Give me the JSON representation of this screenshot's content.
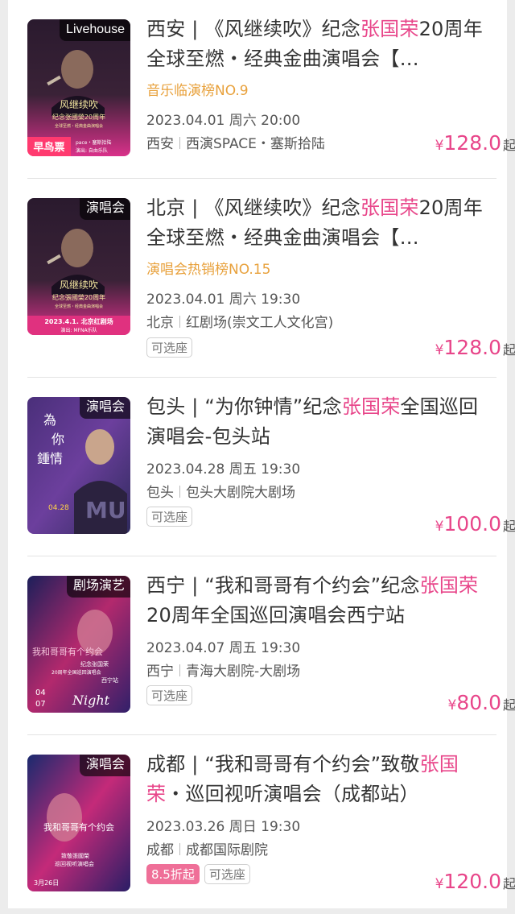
{
  "items": [
    {
      "tag": "Livehouse",
      "title_pre": "西安 | 《风继续吹》纪念",
      "title_hl": "张国荣",
      "title_post": "20周年全球至燃・经典金曲演唱会【…",
      "rank": "音乐临演榜NO.9",
      "date": "2023.04.01 周六 20:00",
      "city": "西安",
      "venue": "西演SPACE・塞斯拾陆",
      "badges": [],
      "currency": "¥",
      "price": "128.0",
      "price_suffix": "起",
      "poster_texts": [
        "风继续吹",
        "纪念张國榮20周年",
        "全球至燃・经典金曲演唱会",
        "早鸟票",
        "pace・塞斯拾陆",
        "演出: 自由乐队"
      ]
    },
    {
      "tag": "演唱会",
      "title_pre": "北京 | 《风继续吹》纪念",
      "title_hl": "张国荣",
      "title_post": "20周年全球至燃・经典金曲演唱会【…",
      "rank": "演唱会热销榜NO.15",
      "date": "2023.04.01 周六 19:30",
      "city": "北京",
      "venue": "红剧场(崇文工人文化宫)",
      "badges": [
        "可选座"
      ],
      "currency": "¥",
      "price": "128.0",
      "price_suffix": "起",
      "poster_texts": [
        "风继续吹",
        "纪念張國榮20周年",
        "全球至燃・经典金曲演唱会",
        "2023.4.1. 北京红剧场",
        "演出: MFNA乐队"
      ]
    },
    {
      "tag": "演唱会",
      "title_pre": "包头 | “为你钟情”纪念",
      "title_hl": "张国荣",
      "title_post": "全国巡回演唱会-包头站",
      "rank": "",
      "date": "2023.04.28 周五 19:30",
      "city": "包头",
      "venue": "包头大剧院大剧场",
      "badges": [
        "可选座"
      ],
      "currency": "¥",
      "price": "100.0",
      "price_suffix": "起",
      "poster_texts": [
        "為",
        "你",
        "鍾情",
        "04.28",
        "MU"
      ]
    },
    {
      "tag": "剧场演艺",
      "title_pre": "西宁 | “我和哥哥有个约会”纪念",
      "title_hl": "张国荣",
      "title_post": "20周年全国巡回演唱会西宁站",
      "rank": "",
      "date": "2023.04.07 周五 19:30",
      "city": "西宁",
      "venue": "青海大剧院-大剧场",
      "badges": [
        "可选座"
      ],
      "currency": "¥",
      "price": "80.0",
      "price_suffix": "起",
      "poster_texts": [
        "我和哥哥有个约会",
        "纪念张国荣",
        "20周年全国巡回演唱会",
        "西宁站",
        "04",
        "07",
        "Night"
      ]
    },
    {
      "tag": "演唱会",
      "title_pre": "成都 | “我和哥哥有个约会”致敬",
      "title_hl": "张国荣",
      "title_post": "・巡回视听演唱会（成都站）",
      "rank": "",
      "date": "2023.03.26 周日 19:30",
      "city": "成都",
      "venue": "成都国际剧院",
      "badges": [
        "8.5折起",
        "可选座"
      ],
      "currency": "¥",
      "price": "120.0",
      "price_suffix": "起",
      "poster_texts": [
        "我和哥哥有个约会",
        "致敬張國榮",
        "巡回视听演唱会",
        "3月26日"
      ]
    }
  ]
}
